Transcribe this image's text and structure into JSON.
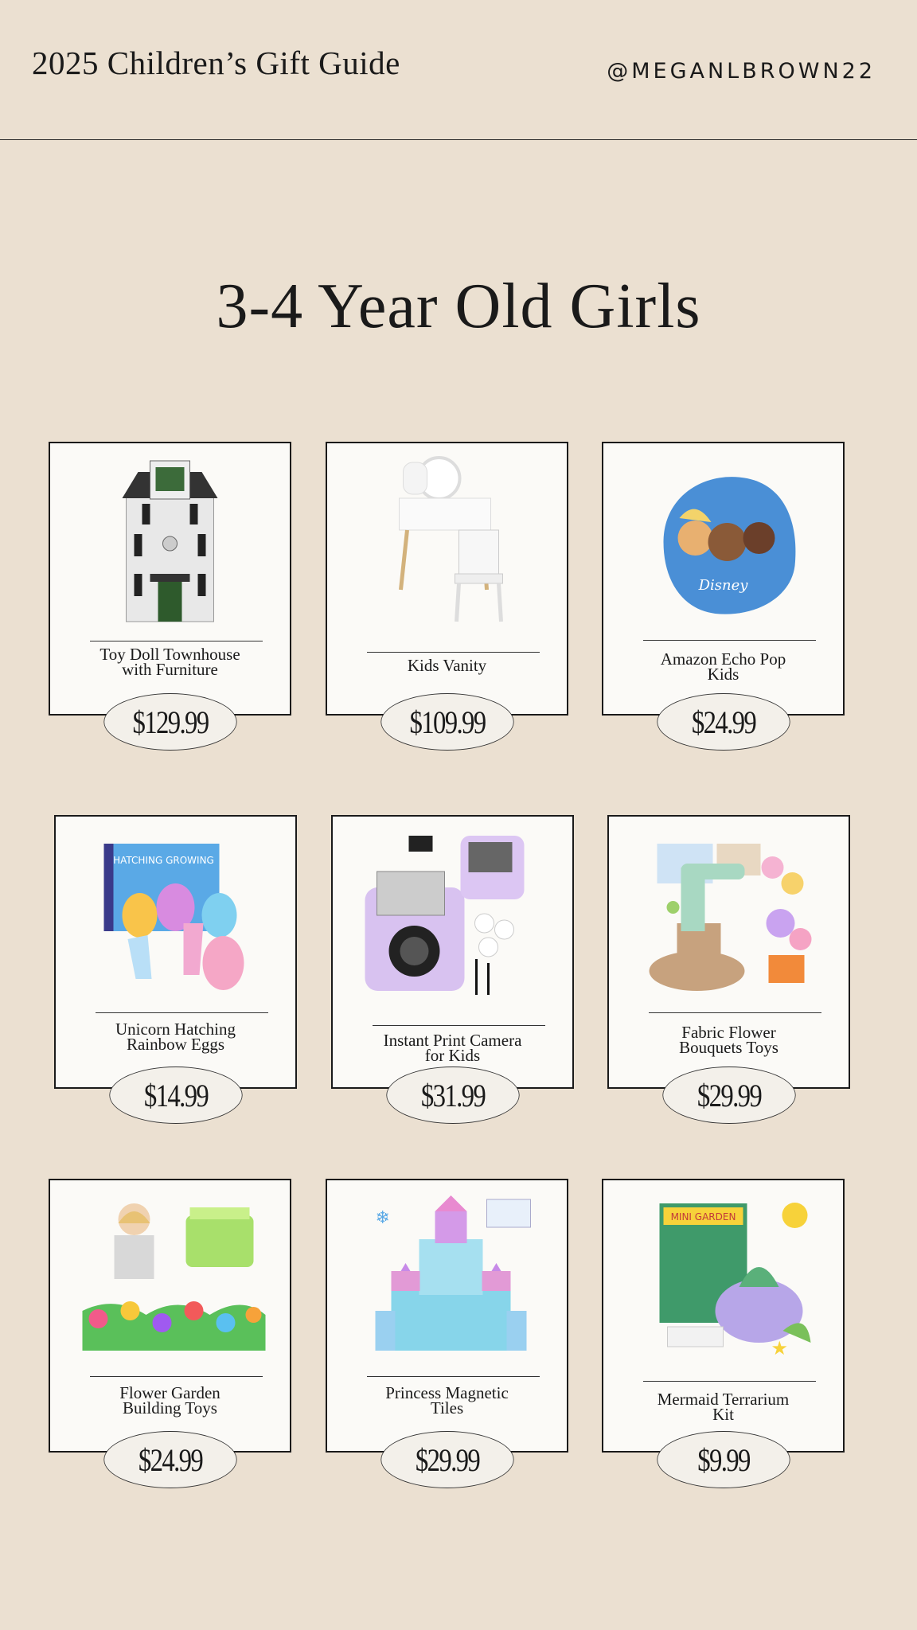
{
  "header": {
    "title": "2025 Children’s Gift Guide",
    "handle": "@MEGANLBROWN22"
  },
  "page_title": "3-4 Year Old Girls",
  "products": [
    {
      "name_lines": [
        "Toy Doll Townhouse",
        "with Furniture"
      ],
      "price": "$129.99",
      "image": "dollhouse"
    },
    {
      "name_lines": [
        "Kids Vanity"
      ],
      "price": "$109.99",
      "image": "vanity"
    },
    {
      "name_lines": [
        "Amazon Echo Pop",
        "Kids"
      ],
      "price": "$24.99",
      "image": "echo-pop"
    },
    {
      "name_lines": [
        "Unicorn Hatching",
        "Rainbow Eggs"
      ],
      "price": "$14.99",
      "image": "unicorn-eggs"
    },
    {
      "name_lines": [
        "Instant Print Camera",
        "for Kids"
      ],
      "price": "$31.99",
      "image": "camera"
    },
    {
      "name_lines": [
        "Fabric Flower",
        "Bouquets Toys"
      ],
      "price": "$29.99",
      "image": "flower-bouquets"
    },
    {
      "name_lines": [
        "Flower Garden",
        "Building Toys"
      ],
      "price": "$24.99",
      "image": "flower-garden"
    },
    {
      "name_lines": [
        "Princess Magnetic",
        "Tiles"
      ],
      "price": "$29.99",
      "image": "magnetic-tiles"
    },
    {
      "name_lines": [
        "Mermaid Terrarium",
        "Kit"
      ],
      "price": "$9.99",
      "image": "terrarium"
    }
  ]
}
